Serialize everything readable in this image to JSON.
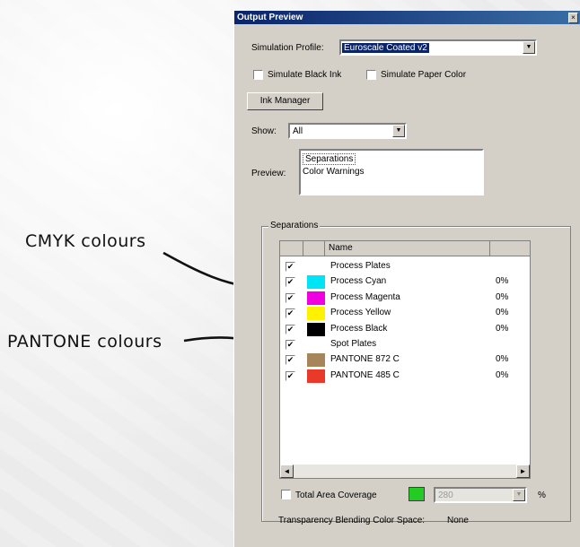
{
  "annotations": {
    "cmyk": "CMYK colours",
    "pantone": "PANTONE colours"
  },
  "window": {
    "title": "Output Preview",
    "close_glyph": "×"
  },
  "simulation": {
    "label": "Simulation Profile:",
    "value": "Euroscale Coated v2"
  },
  "simulate_black_ink": {
    "label": "Simulate Black Ink",
    "checked": false
  },
  "simulate_paper_color": {
    "label": "Simulate Paper Color",
    "checked": false
  },
  "ink_manager": {
    "label": "Ink Manager"
  },
  "show": {
    "label": "Show:",
    "value": "All"
  },
  "preview": {
    "label": "Preview:",
    "options": [
      "Separations",
      "Color Warnings"
    ],
    "selected": "Separations"
  },
  "separations": {
    "group_label": "Separations",
    "columns": [
      "Name"
    ],
    "rows": [
      {
        "name": "Process Plates",
        "checked": true,
        "swatch": "",
        "percent": ""
      },
      {
        "name": "Process Cyan",
        "checked": true,
        "swatch": "#00e5f5",
        "percent": "0%"
      },
      {
        "name": "Process Magenta",
        "checked": true,
        "swatch": "#f000e0",
        "percent": "0%"
      },
      {
        "name": "Process Yellow",
        "checked": true,
        "swatch": "#fff200",
        "percent": "0%"
      },
      {
        "name": "Process Black",
        "checked": true,
        "swatch": "#000000",
        "percent": "0%"
      },
      {
        "name": "Spot Plates",
        "checked": true,
        "swatch": "",
        "percent": ""
      },
      {
        "name": "PANTONE 872 C",
        "checked": true,
        "swatch": "#a6855a",
        "percent": "0%"
      },
      {
        "name": "PANTONE 485 C",
        "checked": true,
        "swatch": "#e8392b",
        "percent": "0%"
      }
    ],
    "scroll_left": "◄",
    "scroll_right": "►"
  },
  "total_area_coverage": {
    "label": "Total Area Coverage",
    "checked": false,
    "color": "#22cc22",
    "value": "280",
    "unit": "%"
  },
  "transparency": {
    "label": "Transparency Blending Color Space:",
    "value": "None"
  },
  "check_glyph": "✔",
  "combo_arrow": "▼"
}
